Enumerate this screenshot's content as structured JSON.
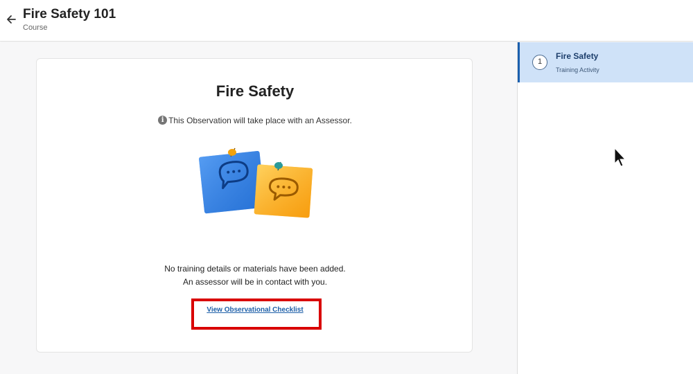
{
  "header": {
    "title": "Fire Safety 101",
    "subtitle": "Course"
  },
  "card": {
    "title": "Fire Safety",
    "info_text": "This Observation will take place with an Assessor.",
    "info_icon": "info-icon",
    "message_line1": "No training details or materials have been added.",
    "message_line2": "An assessor will be in contact with you.",
    "link_label": "View Observational Checklist",
    "highlight_color": "#d90000"
  },
  "sidebar": {
    "items": [
      {
        "number": "1",
        "title": "Fire Safety",
        "subtitle": "Training Activity",
        "selected": true
      }
    ]
  },
  "colors": {
    "accent": "#1a5fae",
    "selected_bg": "#cfe2f8",
    "link": "#1d5fa8"
  }
}
